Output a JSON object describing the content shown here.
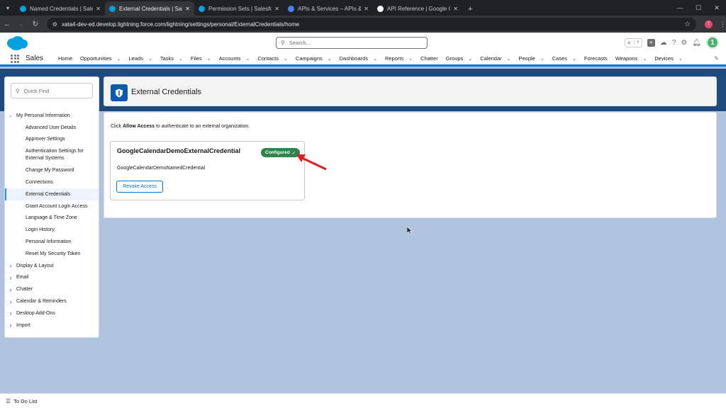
{
  "browser": {
    "tabs": [
      {
        "title": "Named Credentials | Salesforce",
        "favicon_color": "#00a1e0"
      },
      {
        "title": "External Credentials | Salesforce",
        "favicon_color": "#00a1e0",
        "active": true
      },
      {
        "title": "Permission Sets | Salesforce",
        "favicon_color": "#00a1e0"
      },
      {
        "title": "APIs & Services – APIs & Services",
        "favicon_color": "#4285f4"
      },
      {
        "title": "API Reference | Google Calendar",
        "favicon_color": "#ffffff"
      }
    ],
    "url": "xata4-dev-ed.develop.lightning.force.com/lightning/settings/personal/ExternalCredentials/home",
    "profile_initial": "T"
  },
  "header": {
    "search_placeholder": "Search...",
    "avatar_label": "1"
  },
  "nav": {
    "app_name": "Sales",
    "items": [
      {
        "label": "Home",
        "chevron": false
      },
      {
        "label": "Opportunities",
        "chevron": true
      },
      {
        "label": "Leads",
        "chevron": true
      },
      {
        "label": "Tasks",
        "chevron": true
      },
      {
        "label": "Files",
        "chevron": true
      },
      {
        "label": "Accounts",
        "chevron": true
      },
      {
        "label": "Contacts",
        "chevron": true
      },
      {
        "label": "Campaigns",
        "chevron": true
      },
      {
        "label": "Dashboards",
        "chevron": true
      },
      {
        "label": "Reports",
        "chevron": true
      },
      {
        "label": "Chatter",
        "chevron": false
      },
      {
        "label": "Groups",
        "chevron": true
      },
      {
        "label": "Calendar",
        "chevron": true
      },
      {
        "label": "People",
        "chevron": true
      },
      {
        "label": "Cases",
        "chevron": true
      },
      {
        "label": "Forecasts",
        "chevron": false
      },
      {
        "label": "Weapons",
        "chevron": true
      },
      {
        "label": "Devices",
        "chevron": true
      }
    ]
  },
  "sidebar": {
    "quick_find_placeholder": "Quick Find",
    "sections": [
      {
        "label": "My Personal Information",
        "expanded": true,
        "children": [
          "Advanced User Details",
          "Approver Settings",
          "Authentication Settings for External Systems",
          "Change My Password",
          "Connections",
          "External Credentials",
          "Grant Account Login Access",
          "Language & Time Zone",
          "Login History",
          "Personal Information",
          "Reset My Security Token"
        ]
      },
      {
        "label": "Display & Layout"
      },
      {
        "label": "Email"
      },
      {
        "label": "Chatter"
      },
      {
        "label": "Calendar & Reminders"
      },
      {
        "label": "Desktop Add-Ons"
      },
      {
        "label": "Import"
      }
    ],
    "active_item": "External Credentials"
  },
  "page": {
    "title": "External Credentials",
    "intro_prefix": "Click ",
    "intro_bold": "Allow Access",
    "intro_suffix": " to authenticate to an external organization."
  },
  "credential": {
    "name": "GoogleCalendarDemoExternalCredential",
    "status": "Configured",
    "named_credential": "GoogleCalendarDemoNamedCredential",
    "revoke_label": "Revoke Access"
  },
  "utility": {
    "todo_label": "To Do List"
  },
  "colors": {
    "brand": "#0176d3",
    "success": "#2e844a",
    "annotation_arrow": "#e02020"
  }
}
